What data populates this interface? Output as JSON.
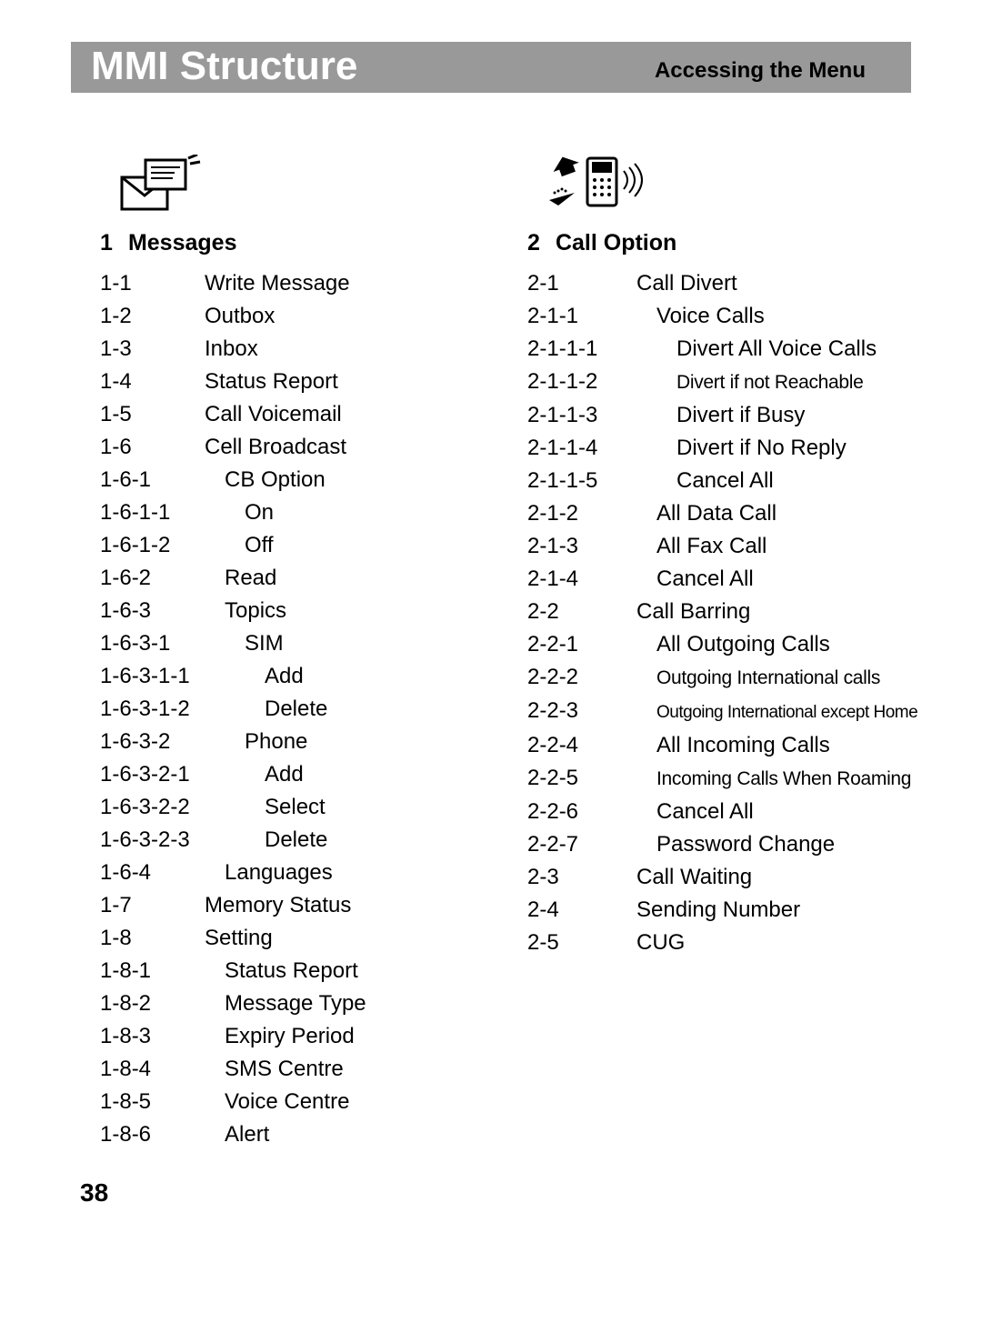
{
  "header": {
    "title": "MMI Structure",
    "subtitle": "Accessing the Menu"
  },
  "page_number": "38",
  "sections": {
    "messages": {
      "num": "1",
      "title": "Messages",
      "items": [
        {
          "code": "1-1",
          "label": "Write Message",
          "indent": 0
        },
        {
          "code": "1-2",
          "label": "Outbox",
          "indent": 0
        },
        {
          "code": "1-3",
          "label": "Inbox",
          "indent": 0
        },
        {
          "code": "1-4",
          "label": "Status Report",
          "indent": 0
        },
        {
          "code": "1-5",
          "label": "Call Voicemail",
          "indent": 0
        },
        {
          "code": "1-6",
          "label": "Cell Broadcast",
          "indent": 0
        },
        {
          "code": "1-6-1",
          "label": "CB Option",
          "indent": 1
        },
        {
          "code": "1-6-1-1",
          "label": "On",
          "indent": 2
        },
        {
          "code": "1-6-1-2",
          "label": "Off",
          "indent": 2
        },
        {
          "code": "1-6-2",
          "label": "Read",
          "indent": 1
        },
        {
          "code": "1-6-3",
          "label": "Topics",
          "indent": 1
        },
        {
          "code": "1-6-3-1",
          "label": "SIM",
          "indent": 2
        },
        {
          "code": "1-6-3-1-1",
          "label": "Add",
          "indent": 3
        },
        {
          "code": "1-6-3-1-2",
          "label": "Delete",
          "indent": 3
        },
        {
          "code": "1-6-3-2",
          "label": "Phone",
          "indent": 2
        },
        {
          "code": "1-6-3-2-1",
          "label": "Add",
          "indent": 3
        },
        {
          "code": "1-6-3-2-2",
          "label": "Select",
          "indent": 3
        },
        {
          "code": "1-6-3-2-3",
          "label": "Delete",
          "indent": 3
        },
        {
          "code": "1-6-4",
          "label": "Languages",
          "indent": 1
        },
        {
          "code": "1-7",
          "label": "Memory Status",
          "indent": 0
        },
        {
          "code": "1-8",
          "label": "Setting",
          "indent": 0
        },
        {
          "code": "1-8-1",
          "label": "Status Report",
          "indent": 1
        },
        {
          "code": "1-8-2",
          "label": "Message Type",
          "indent": 1
        },
        {
          "code": "1-8-3",
          "label": "Expiry Period",
          "indent": 1
        },
        {
          "code": "1-8-4",
          "label": "SMS Centre",
          "indent": 1
        },
        {
          "code": "1-8-5",
          "label": "Voice Centre",
          "indent": 1
        },
        {
          "code": "1-8-6",
          "label": "Alert",
          "indent": 1
        }
      ]
    },
    "calloption": {
      "num": "2",
      "title": "Call Option",
      "items": [
        {
          "code": "2-1",
          "label": "Call Divert",
          "indent": 0
        },
        {
          "code": "2-1-1",
          "label": "Voice Calls",
          "indent": 1
        },
        {
          "code": "2-1-1-1",
          "label": "Divert All Voice Calls",
          "indent": 2
        },
        {
          "code": "2-1-1-2",
          "label": "Divert if not Reachable",
          "indent": 2,
          "size": "small"
        },
        {
          "code": "2-1-1-3",
          "label": "Divert if Busy",
          "indent": 2
        },
        {
          "code": "2-1-1-4",
          "label": "Divert if No Reply",
          "indent": 2
        },
        {
          "code": "2-1-1-5",
          "label": "Cancel All",
          "indent": 2
        },
        {
          "code": "2-1-2",
          "label": "All Data Call",
          "indent": 1
        },
        {
          "code": "2-1-3",
          "label": "All Fax Call",
          "indent": 1
        },
        {
          "code": "2-1-4",
          "label": "Cancel All",
          "indent": 1
        },
        {
          "code": "2-2",
          "label": "Call Barring",
          "indent": 0
        },
        {
          "code": "2-2-1",
          "label": "All Outgoing Calls",
          "indent": 1
        },
        {
          "code": "2-2-2",
          "label": "Outgoing International calls",
          "indent": 1,
          "size": "small"
        },
        {
          "code": "2-2-3",
          "label": "Outgoing International except Home",
          "indent": 1,
          "size": "tiny"
        },
        {
          "code": "2-2-4",
          "label": "All Incoming Calls",
          "indent": 1
        },
        {
          "code": "2-2-5",
          "label": "Incoming Calls When Roaming",
          "indent": 1,
          "size": "small"
        },
        {
          "code": "2-2-6",
          "label": "Cancel All",
          "indent": 1
        },
        {
          "code": "2-2-7",
          "label": "Password Change",
          "indent": 1
        },
        {
          "code": "2-3",
          "label": "Call Waiting",
          "indent": 0
        },
        {
          "code": "2-4",
          "label": "Sending Number",
          "indent": 0
        },
        {
          "code": "2-5",
          "label": "CUG",
          "indent": 0
        }
      ]
    }
  }
}
